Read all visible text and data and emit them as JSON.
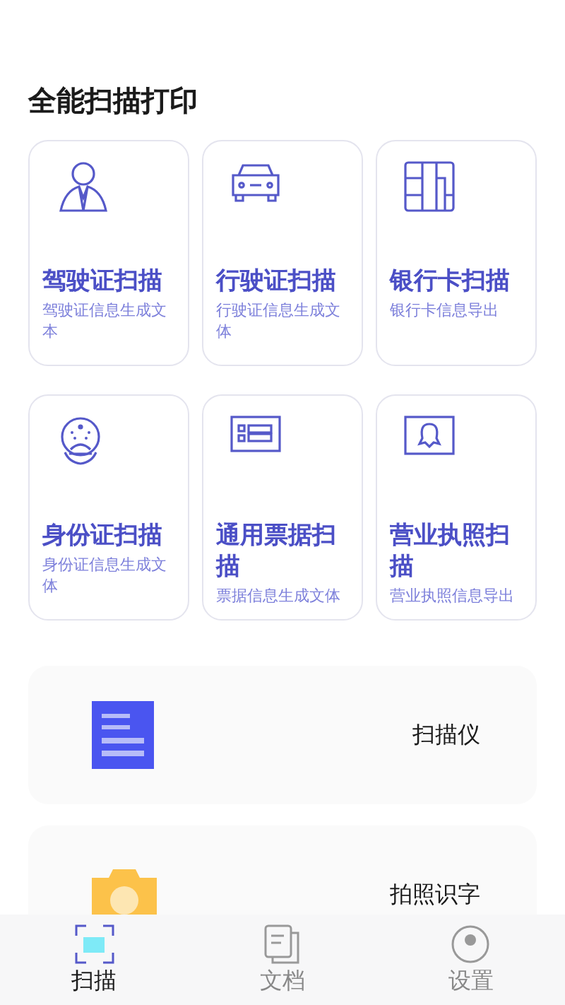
{
  "section_title": "全能扫描打印",
  "tools": [
    {
      "kind": "person",
      "title": "驾驶证扫描",
      "subtitle": "驾驶证信息生成文本"
    },
    {
      "kind": "car",
      "title": "行驶证扫描",
      "subtitle": "行驶证信息生成文体"
    },
    {
      "kind": "bankcard",
      "title": "银行卡扫描",
      "subtitle": "银行卡信息导出"
    },
    {
      "kind": "emblem",
      "title": "身份证扫描",
      "subtitle": "身份证信息生成文体"
    },
    {
      "kind": "ticket",
      "title": "通用票据扫描",
      "subtitle": "票据信息生成文体"
    },
    {
      "kind": "license",
      "title": "营业执照扫描",
      "subtitle": "营业执照信息导出"
    }
  ],
  "features": [
    {
      "kind": "document",
      "label": "扫描仪"
    },
    {
      "kind": "camera",
      "label": "拍照识字"
    }
  ],
  "nav": [
    {
      "kind": "scan",
      "label": "扫描",
      "selected": true
    },
    {
      "kind": "docs",
      "label": "文档",
      "selected": false
    },
    {
      "kind": "settings",
      "label": "设置",
      "selected": false
    }
  ]
}
